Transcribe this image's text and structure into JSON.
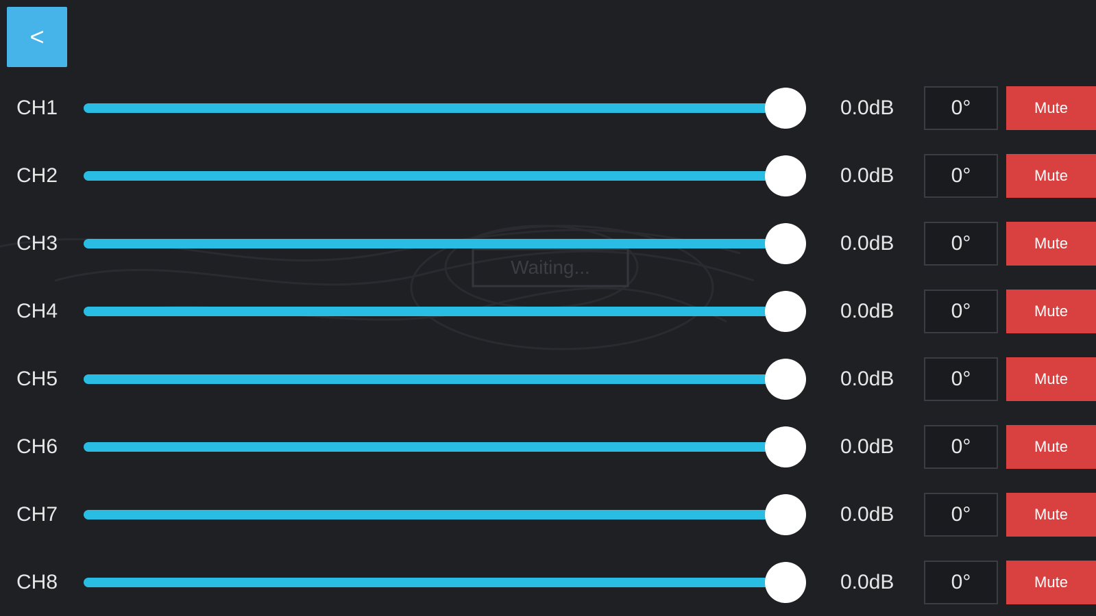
{
  "back_button": {
    "label": "<"
  },
  "watermark_text": "Waiting...",
  "colors": {
    "background": "#1f2024",
    "accent": "#29bde4",
    "back_button": "#46b4e8",
    "mute": "#d94040"
  },
  "channels": [
    {
      "label": "CH1",
      "gain": "0.0dB",
      "phase": "0°",
      "mute_label": "Mute",
      "level": 1.0
    },
    {
      "label": "CH2",
      "gain": "0.0dB",
      "phase": "0°",
      "mute_label": "Mute",
      "level": 1.0
    },
    {
      "label": "CH3",
      "gain": "0.0dB",
      "phase": "0°",
      "mute_label": "Mute",
      "level": 1.0
    },
    {
      "label": "CH4",
      "gain": "0.0dB",
      "phase": "0°",
      "mute_label": "Mute",
      "level": 1.0
    },
    {
      "label": "CH5",
      "gain": "0.0dB",
      "phase": "0°",
      "mute_label": "Mute",
      "level": 1.0
    },
    {
      "label": "CH6",
      "gain": "0.0dB",
      "phase": "0°",
      "mute_label": "Mute",
      "level": 1.0
    },
    {
      "label": "CH7",
      "gain": "0.0dB",
      "phase": "0°",
      "mute_label": "Mute",
      "level": 1.0
    },
    {
      "label": "CH8",
      "gain": "0.0dB",
      "phase": "0°",
      "mute_label": "Mute",
      "level": 1.0
    }
  ]
}
